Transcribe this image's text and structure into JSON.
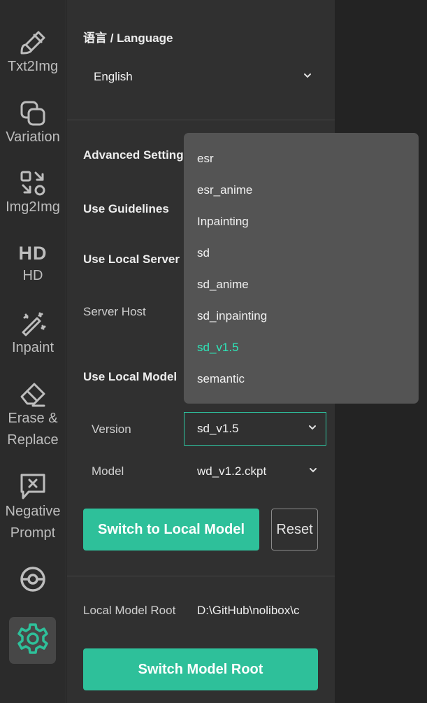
{
  "sidebar": {
    "items": [
      {
        "label": "Txt2Img",
        "icon": "brush-icon"
      },
      {
        "label": "Variation",
        "icon": "overlap-squares-icon"
      },
      {
        "label": "Img2Img",
        "icon": "transform-icon"
      },
      {
        "label": "HD",
        "glyph": "HD",
        "icon": "hd-icon"
      },
      {
        "label": "Inpaint",
        "icon": "magic-wand-icon"
      },
      {
        "label_line1": "Erase &",
        "label_line2": "Replace",
        "icon": "eraser-icon"
      },
      {
        "label_line1": "Negative",
        "label_line2": "Prompt",
        "icon": "negative-prompt-icon"
      },
      {
        "icon": "pokeball-icon"
      },
      {
        "icon": "gear-icon",
        "active": true
      }
    ]
  },
  "settings": {
    "language_heading": "语言 / Language",
    "language_value": "English",
    "advanced_heading": "Advanced Settings",
    "use_guidelines": "Use Guidelines",
    "use_local_server": "Use Local Server",
    "server_host": "Server Host",
    "use_local_model": "Use Local Model",
    "version_label": "Version",
    "version_value": "sd_v1.5",
    "model_label": "Model",
    "model_value": "wd_v1.2.ckpt",
    "switch_local_model_button": "Switch to Local Model",
    "reset_button": "Reset",
    "local_model_root_label": "Local Model Root",
    "local_model_root_value": "D:\\GitHub\\nolibox\\c",
    "switch_model_root_button": "Switch Model Root"
  },
  "version_dropdown": {
    "options": [
      "esr",
      "esr_anime",
      "Inpainting",
      "sd",
      "sd_anime",
      "sd_inpainting",
      "sd_v1.5",
      "semantic"
    ],
    "selected": "sd_v1.5"
  },
  "colors": {
    "accent": "#2ec09a",
    "selected_option": "#2ee6b8",
    "panel_bg": "#303030",
    "rail_bg": "#2b2b2b",
    "dropdown_bg": "#545454"
  }
}
